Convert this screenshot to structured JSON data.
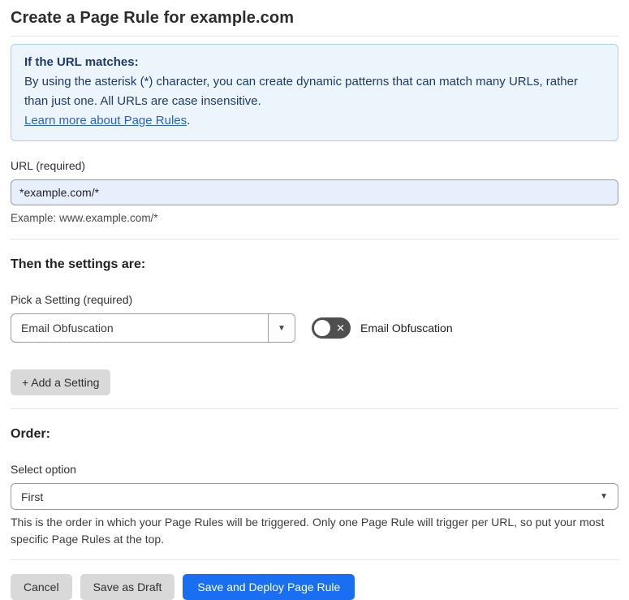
{
  "page": {
    "title": "Create a Page Rule for example.com"
  },
  "info_box": {
    "heading": "If the URL matches:",
    "body": "By using the asterisk (*) character, you can create dynamic patterns that can match many URLs, rather than just one. All URLs are case insensitive.",
    "link_label": "Learn more about Page Rules",
    "link_suffix": "."
  },
  "url_field": {
    "label": "URL (required)",
    "value": "*example.com/*",
    "helper": "Example: www.example.com/*"
  },
  "settings_section": {
    "heading": "Then the settings are:",
    "picker_label": "Pick a Setting (required)",
    "picker_value": "Email Obfuscation",
    "toggle_state": "off",
    "toggle_label": "Email Obfuscation",
    "add_setting_label": "+ Add a Setting"
  },
  "order_section": {
    "heading": "Order:",
    "select_label": "Select option",
    "select_value": "First",
    "helper": "This is the order in which your Page Rules will be triggered. Only one Page Rule will trigger per URL, so put your most specific Page Rules at the top."
  },
  "footer": {
    "cancel_label": "Cancel",
    "save_draft_label": "Save as Draft",
    "save_deploy_label": "Save and Deploy Page Rule"
  },
  "icons": {
    "dropdown_caret": "▼",
    "select_caret": "▼",
    "toggle_x": "✕"
  },
  "colors": {
    "accent_blue": "#1a6ef2",
    "info_bg": "#edf5fc",
    "info_border": "#a9d2ef",
    "info_text": "#1e3a6d",
    "link_blue": "#2862c9",
    "input_bg": "#e8effc",
    "toggle_bg": "#4f4f4f",
    "button_gray": "#d9d9d9"
  }
}
